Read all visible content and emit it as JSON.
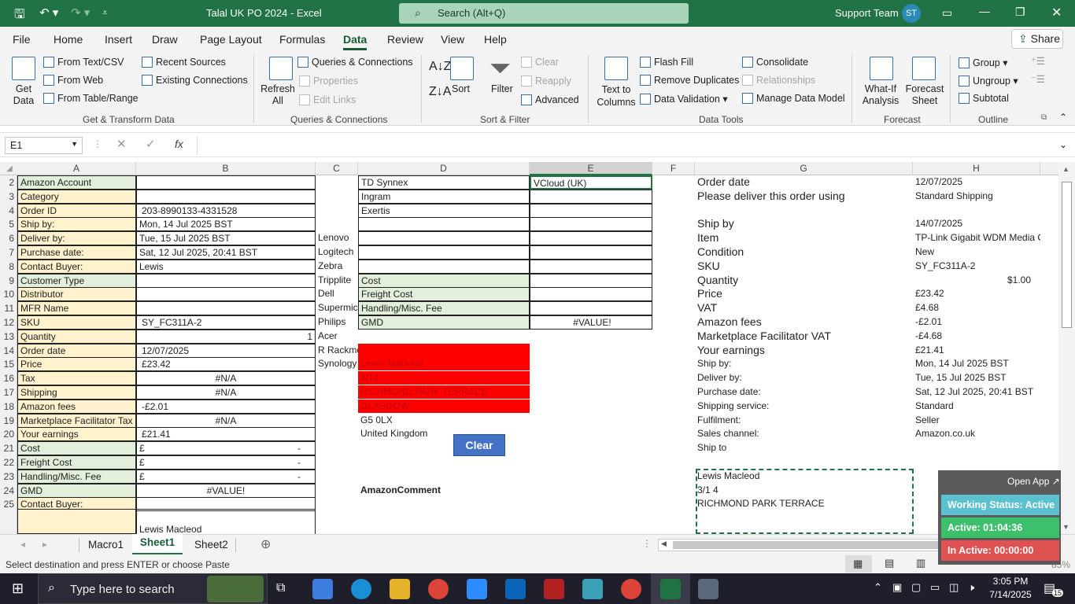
{
  "app": {
    "title": "Talal UK PO 2024  -  Excel",
    "search_placeholder": "Search (Alt+Q)",
    "user": "Support Team",
    "initials": "ST"
  },
  "menu": [
    "File",
    "Home",
    "Insert",
    "Draw",
    "Page Layout",
    "Formulas",
    "Data",
    "Review",
    "View",
    "Help"
  ],
  "share": "Share",
  "ribbon": {
    "get_data": "Get Data",
    "from_text": "From Text/CSV",
    "from_web": "From Web",
    "from_table": "From Table/Range",
    "recent": "Recent Sources",
    "existing": "Existing Connections",
    "group1": "Get & Transform Data",
    "refresh": "Refresh All",
    "queries": "Queries & Connections",
    "properties": "Properties",
    "edit_links": "Edit Links",
    "group2": "Queries & Connections",
    "sort": "Sort",
    "filter": "Filter",
    "clear": "Clear",
    "reapply": "Reapply",
    "advanced": "Advanced",
    "group3": "Sort & Filter",
    "text_to_columns": "Text to Columns",
    "flash_fill": "Flash Fill",
    "remove_dup": "Remove Duplicates",
    "data_validation": "Data Validation",
    "consolidate": "Consolidate",
    "relationships": "Relationships",
    "manage_model": "Manage Data Model",
    "group4": "Data Tools",
    "whatif": "What-If Analysis",
    "forecast_sheet": "Forecast Sheet",
    "group5": "Forecast",
    "group": "Group",
    "ungroup": "Ungroup",
    "subtotal": "Subtotal",
    "group6": "Outline"
  },
  "formula": {
    "namebox": "E1",
    "fx": "fx",
    "value": ""
  },
  "columns": [
    "A",
    "B",
    "C",
    "D",
    "E",
    "F",
    "G",
    "H"
  ],
  "rows": [
    "2",
    "3",
    "4",
    "5",
    "6",
    "7",
    "8",
    "9",
    "10",
    "11",
    "12",
    "13",
    "14",
    "15",
    "16",
    "17",
    "18",
    "19",
    "20",
    "21",
    "22",
    "23",
    "24",
    "25"
  ],
  "colA": [
    "Amazon Account",
    "Category",
    "Order ID",
    "Ship by:",
    "Deliver by:",
    "Purchase date:",
    "Contact Buyer:",
    "Customer Type",
    "Distributor",
    "MFR Name",
    "SKU",
    "Quantity",
    "Order date",
    "Price",
    "Tax",
    "Shipping",
    "Amazon fees",
    "Marketplace Facilitator Tax",
    "Your earnings",
    "Cost",
    "Freight Cost",
    "Handling/Misc. Fee",
    "GMD",
    "Contact Buyer:"
  ],
  "colB": [
    "",
    "",
    "203-8990133-4331528",
    "Mon, 14 Jul 2025 BST",
    "Tue, 15 Jul 2025 BST",
    "Sat, 12 Jul 2025, 20:41 BST",
    "Lewis",
    "",
    "",
    "",
    "SY_FC311A-2",
    "1",
    "12/07/2025",
    "£23.42",
    "#N/A",
    "#N/A",
    "-£2.01",
    "#N/A",
    "£21.41",
    "£",
    "£",
    "£",
    "#VALUE!",
    ""
  ],
  "colB_dash": "-",
  "b26": "Lewis Macleod",
  "colC": [
    "",
    "",
    "",
    "",
    "Lenovo",
    "Logitech",
    "Zebra",
    "Tripplite",
    "Dell",
    "Supermic",
    "Philips",
    "Acer",
    "R Rackmount",
    "Synology"
  ],
  "colD_top": [
    "TD Synnex",
    "Ingram",
    "Exertis"
  ],
  "colD_cost": [
    "Cost",
    "Freight Cost",
    "Handling/Misc. Fee",
    "GMD"
  ],
  "e2": "VCloud (UK)",
  "e12": "#VALUE!",
  "colD_red": [
    "",
    "Lewis Macleod",
    "3/14",
    "RICHMOND PARK TERRACE",
    "GLASGOW"
  ],
  "d19": "G5 0LX",
  "d20": "United Kingdom",
  "d24": "AmazonComment",
  "clear_btn": "Clear",
  "colG": [
    "Order date",
    "Please deliver this order using",
    "",
    "Ship by",
    "Item",
    "Condition",
    "SKU",
    "Quantity",
    "Price",
    "VAT",
    "Amazon fees",
    "Marketplace Facilitator VAT",
    "Your earnings",
    "Ship by:",
    "Deliver by:",
    "Purchase date:",
    "Shipping service:",
    "Fulfilment:",
    "Sales channel:",
    "Ship to",
    "",
    "Lewis Macleod",
    "3/1 4",
    "RICHMOND PARK TERRACE"
  ],
  "colH": [
    "12/07/2025",
    "Standard Shipping",
    "",
    "14/07/2025",
    "TP-Link Gigabit WDM Media Conv",
    "New",
    "SY_FC311A-2",
    "$1.00",
    "£23.42",
    "£4.68",
    "-£2.01",
    "-£4.68",
    "£21.41",
    "Mon, 14 Jul 2025 BST",
    "Tue, 15 Jul 2025 BST",
    "Sat, 12 Jul 2025, 20:41 BST",
    "Standard",
    "Seller",
    "Amazon.co.uk",
    "",
    "",
    "",
    "",
    ""
  ],
  "sheets": [
    "Macro1",
    "Sheet1",
    "Sheet2"
  ],
  "status": "Select destination and press ENTER or choose Paste",
  "zoom": "85%",
  "widget": {
    "open": "Open App ↗",
    "working": "Working Status: Active",
    "active": "Active: 01:04:36",
    "inactive": "In Active: 00:00:00"
  },
  "taskbar": {
    "search": "Type here to search",
    "time": "3:05 PM",
    "date": "7/14/2025",
    "badge": "15"
  }
}
